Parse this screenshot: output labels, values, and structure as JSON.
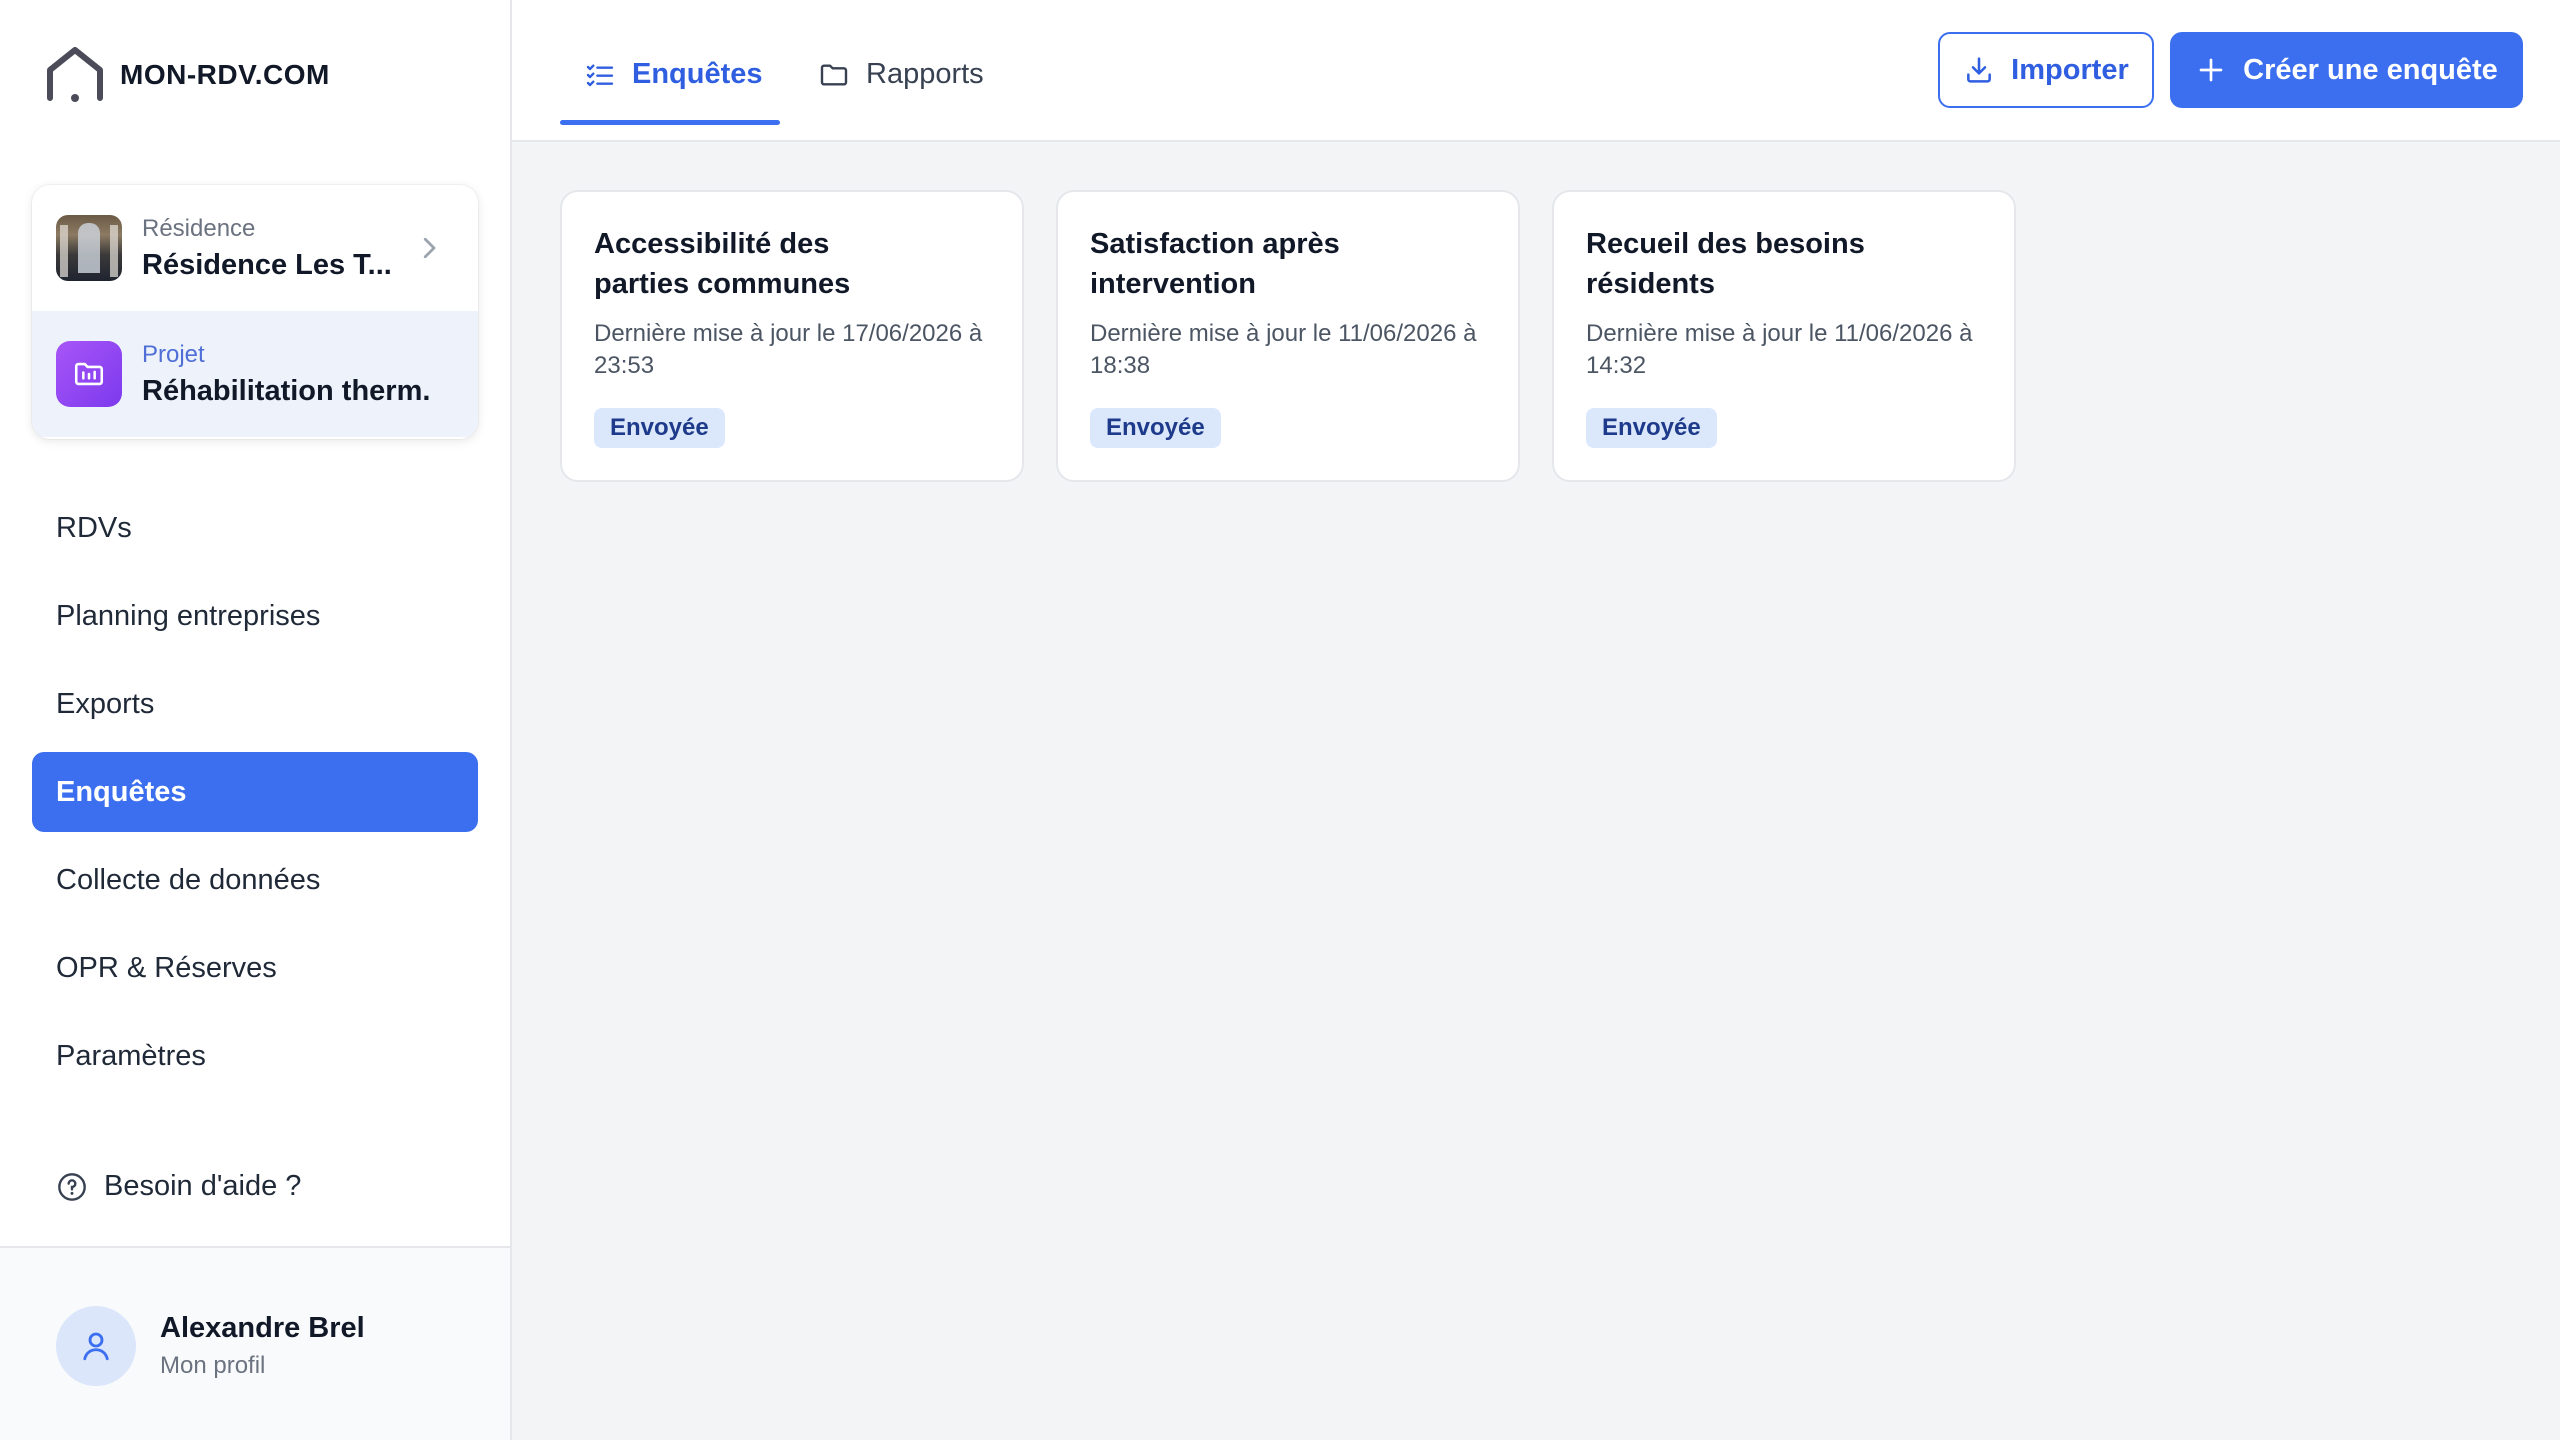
{
  "brand": {
    "name": "MON-RDV.COM"
  },
  "context": {
    "residence": {
      "label": "Résidence",
      "value": "Résidence Les T..."
    },
    "project": {
      "label": "Projet",
      "value": "Réhabilitation therm..."
    }
  },
  "nav": {
    "items": [
      {
        "label": "RDVs"
      },
      {
        "label": "Planning entreprises"
      },
      {
        "label": "Exports"
      },
      {
        "label": "Enquêtes",
        "active": true
      },
      {
        "label": "Collecte de données"
      },
      {
        "label": "OPR & Réserves"
      },
      {
        "label": "Paramètres"
      }
    ]
  },
  "help": {
    "label": "Besoin d'aide ?"
  },
  "profile": {
    "name": "Alexandre Brel",
    "subtitle": "Mon profil"
  },
  "tabs": [
    {
      "label": "Enquêtes",
      "icon": "checklist-icon",
      "active": true
    },
    {
      "label": "Rapports",
      "icon": "folder-icon"
    }
  ],
  "actions": {
    "import_label": "Importer",
    "create_label": "Créer une enquête"
  },
  "surveys": [
    {
      "title": "Accessibilité des parties communes",
      "date": "Dernière mise à jour le 17/06/2026 à 23:53",
      "status": "Envoyée"
    },
    {
      "title": "Satisfaction après intervention",
      "date": "Dernière mise à jour le 11/06/2026 à 18:38",
      "status": "Envoyée"
    },
    {
      "title": "Recueil des besoins résidents",
      "date": "Dernière mise à jour le 11/06/2026 à 14:32",
      "status": "Envoyée"
    }
  ],
  "colors": {
    "accent": "#3b6ff0",
    "badge_bg": "#dbe7fb",
    "project_icon": "#8b5cf6"
  }
}
